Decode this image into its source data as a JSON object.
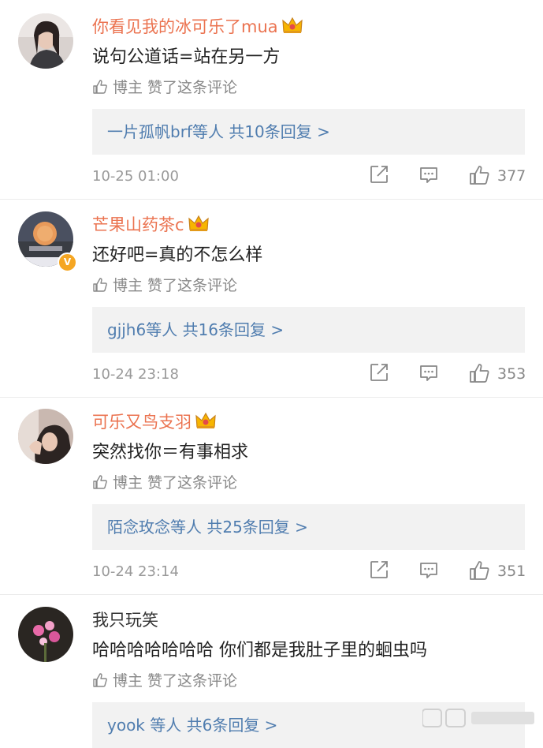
{
  "comments": [
    {
      "username": "你看见我的冰可乐了mua",
      "content": "说句公道话=站在另一方",
      "liked_by": "博主 赞了这条评论",
      "reply_summary": "一片孤帆brf等人  共10条回复 >",
      "time": "10-25 01:00",
      "like_count": "377"
    },
    {
      "username": "芒果山药茶c",
      "content": "还好吧=真的不怎么样",
      "liked_by": "博主 赞了这条评论",
      "reply_summary": "gjjh6等人  共16条回复 >",
      "time": "10-24 23:18",
      "like_count": "353"
    },
    {
      "username": "可乐又鸟支羽",
      "content": "突然找你＝有事相求",
      "liked_by": "博主 赞了这条评论",
      "reply_summary": "陌念玫念等人  共25条回复 >",
      "time": "10-24 23:14",
      "like_count": "351"
    },
    {
      "username": "我只玩笑",
      "content": "哈哈哈哈哈哈哈 你们都是我肚子里的蛔虫吗",
      "liked_by": "博主 赞了这条评论",
      "reply_summary": "yook 等人  共6条回复 >"
    }
  ],
  "colors": {
    "username": "#eb7350",
    "link": "#507daf",
    "meta": "#999999",
    "reply_bg": "#f2f2f2"
  },
  "icons": [
    "crown-badge-icon",
    "verified-badge-icon",
    "thumbs-up-icon",
    "share-icon",
    "comment-icon"
  ]
}
